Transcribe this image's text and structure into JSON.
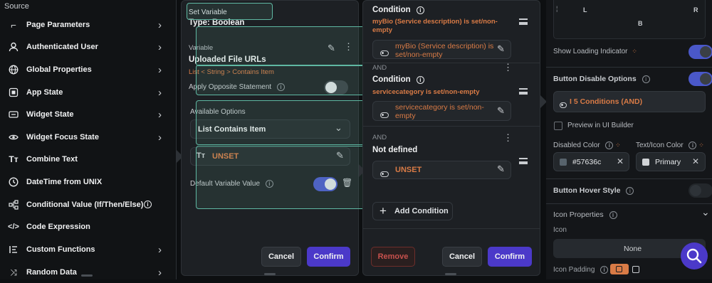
{
  "source": {
    "title": "Source",
    "items": [
      {
        "label": "Page Parameters",
        "icon": "square-bracket-icon",
        "chevron": true
      },
      {
        "label": "Authenticated User",
        "icon": "user-icon",
        "chevron": true
      },
      {
        "label": "Global Properties",
        "icon": "globe-icon",
        "chevron": true
      },
      {
        "label": "App State",
        "icon": "app-state-icon",
        "chevron": true
      },
      {
        "label": "Widget State",
        "icon": "widget-state-icon",
        "chevron": true
      },
      {
        "label": "Widget Focus State",
        "icon": "eye-icon",
        "chevron": true
      },
      {
        "label": "Combine Text",
        "icon": "text-icon",
        "chevron": false
      },
      {
        "label": "DateTime from UNIX",
        "icon": "clock-icon",
        "chevron": false
      },
      {
        "label": "Conditional Value (If/Then/Else)",
        "icon": "branch-icon",
        "chevron": false
      },
      {
        "label": "Code Expression",
        "icon": "code-icon",
        "chevron": false
      },
      {
        "label": "Custom Functions",
        "icon": "function-icon",
        "chevron": true
      },
      {
        "label": "Random Data",
        "icon": "shuffle-icon",
        "chevron": true
      }
    ]
  },
  "set_variable": {
    "header": "Set Variable",
    "type": "Type: Boolean",
    "variable_label": "Variable",
    "variable_name": "Uploaded File URLs",
    "variable_path": "List < String > Contains Item",
    "apply_opposite": "Apply Opposite Statement",
    "available_options_label": "Available Options",
    "option_selected": "List Contains Item",
    "unset_value": "UNSET",
    "default_value_label": "Default Variable Value",
    "cancel": "Cancel",
    "confirm": "Confirm"
  },
  "conditions": {
    "items": [
      {
        "title": "Condition",
        "subtitle": "myBio (Service description) is set/non-empty",
        "value": "myBio (Service description) is set/non-empty",
        "show_info": true
      },
      {
        "joiner": "AND",
        "title": "Condition",
        "subtitle": "servicecategory is set/non-empty",
        "value": "servicecategory is set/non-empty",
        "show_info": true
      },
      {
        "joiner": "AND",
        "title": "Not defined",
        "value": "UNSET",
        "show_info": false
      }
    ],
    "add_condition": "Add Condition",
    "remove": "Remove",
    "cancel": "Cancel",
    "confirm": "Confirm"
  },
  "properties": {
    "padding_labels": {
      "left": "L",
      "right": "R",
      "bottom": "B"
    },
    "show_loading": "Show Loading Indicator",
    "button_disable": "Button Disable Options",
    "conditions_summary": "I 5 Conditions (AND)",
    "preview": "Preview in UI Builder",
    "disabled_color_label": "Disabled Color",
    "text_icon_color_label": "Text/Icon Color",
    "disabled_color_value": "#57636c",
    "disabled_color_hex": "#57636c",
    "text_icon_color_value": "Primary",
    "hover_style": "Button Hover Style",
    "icon_properties": "Icon Properties",
    "icon_label": "Icon",
    "icon_value": "None",
    "icon_padding": "Icon Padding"
  },
  "colors": {
    "accent": "#4b39c9",
    "orange": "#d97b46",
    "highlight": "#5fb8a3",
    "toggle_on": "#4a58c9"
  }
}
